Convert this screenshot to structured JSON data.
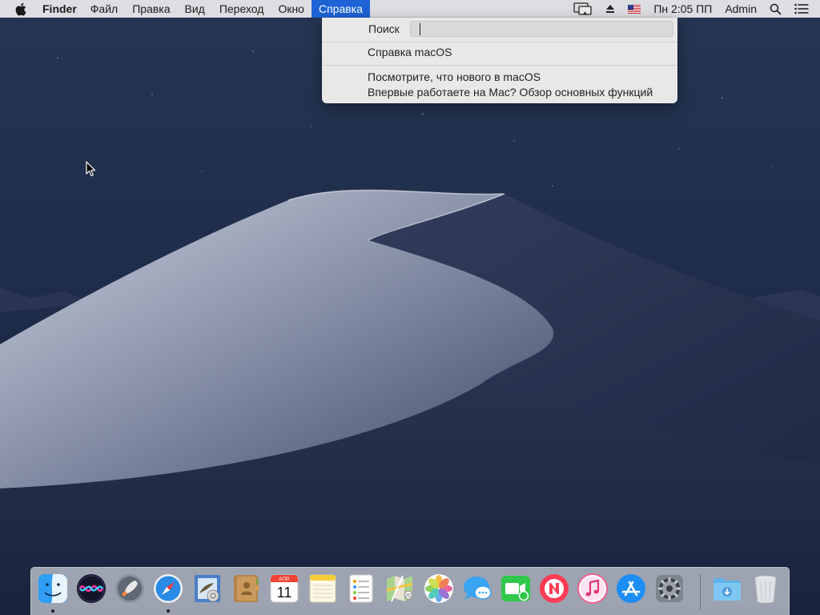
{
  "menubar": {
    "apple_icon": "apple-logo-icon",
    "app_name": "Finder",
    "menus": [
      "Файл",
      "Правка",
      "Вид",
      "Переход",
      "Окно",
      "Справка"
    ],
    "active_menu": "Справка",
    "status": {
      "airplay_icon": "airplay-display-icon",
      "eject_icon": "eject-icon",
      "input_source_icon": "us-flag-icon",
      "clock": "Пн 2:05 ПП",
      "user": "Admin",
      "spotlight_icon": "spotlight-search-icon",
      "notification_icon": "notification-center-icon"
    },
    "active_color": "#1d63d6"
  },
  "help_menu": {
    "search_label": "Поиск",
    "search_value": "",
    "items": [
      "Справка macOS",
      "Посмотрите, что нового в macOS",
      "Впервые работаете на Mac? Обзор основных функций"
    ]
  },
  "dock": {
    "apps": [
      {
        "name": "Finder",
        "icon": "finder-icon",
        "running": true
      },
      {
        "name": "Siri",
        "icon": "siri-icon",
        "running": false
      },
      {
        "name": "Launchpad",
        "icon": "launchpad-icon",
        "running": false
      },
      {
        "name": "Safari",
        "icon": "safari-icon",
        "running": true
      },
      {
        "name": "Mail",
        "icon": "mail-icon",
        "running": false
      },
      {
        "name": "Contacts",
        "icon": "contacts-icon",
        "running": false
      },
      {
        "name": "Calendar",
        "icon": "calendar-icon",
        "running": false
      },
      {
        "name": "Notes",
        "icon": "notes-icon",
        "running": false
      },
      {
        "name": "Reminders",
        "icon": "reminders-icon",
        "running": false
      },
      {
        "name": "Maps",
        "icon": "maps-icon",
        "running": false
      },
      {
        "name": "Photos",
        "icon": "photos-icon",
        "running": false
      },
      {
        "name": "Messages",
        "icon": "messages-icon",
        "running": false
      },
      {
        "name": "FaceTime",
        "icon": "facetime-icon",
        "running": false
      },
      {
        "name": "News",
        "icon": "news-icon",
        "running": false
      },
      {
        "name": "iTunes",
        "icon": "itunes-icon",
        "running": false
      },
      {
        "name": "App Store",
        "icon": "app-store-icon",
        "running": false
      },
      {
        "name": "System Preferences",
        "icon": "system-preferences-icon",
        "running": false
      }
    ],
    "stacks": [
      {
        "name": "Downloads",
        "icon": "downloads-folder-icon"
      },
      {
        "name": "Trash",
        "icon": "trash-icon"
      }
    ],
    "calendar_month": "АПР.",
    "calendar_day": "11"
  },
  "wallpaper": "macos-mojave-dark-dune"
}
